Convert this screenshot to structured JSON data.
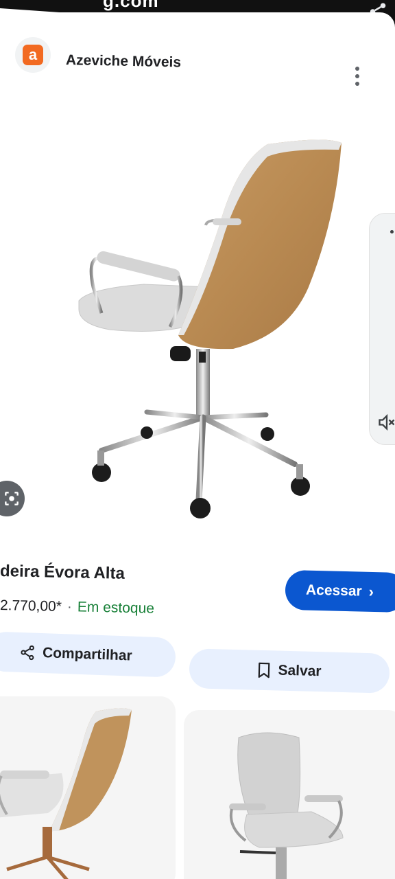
{
  "status": {
    "cut_text": "g.com"
  },
  "source": {
    "logo_letter": "a",
    "logo_color": "#f26a21",
    "name": "Azeviche Móveis"
  },
  "product": {
    "title": "deira Évora Alta",
    "price": "2.770,00*",
    "separator": "·",
    "stock": "Em estoque",
    "stock_color": "#188038"
  },
  "actions": {
    "visit_label": "Acessar",
    "visit_color": "#0b57d0",
    "share_label": "Compartilhar",
    "save_label": "Salvar"
  },
  "icons": {
    "share": "share-icon",
    "menu": "more-vert-icon",
    "lens": "lens-icon",
    "mute": "volume-off-icon",
    "bookmark": "bookmark-icon",
    "chevron": "chevron-right-icon"
  },
  "pager": {
    "count": 4,
    "active_index": 2
  }
}
